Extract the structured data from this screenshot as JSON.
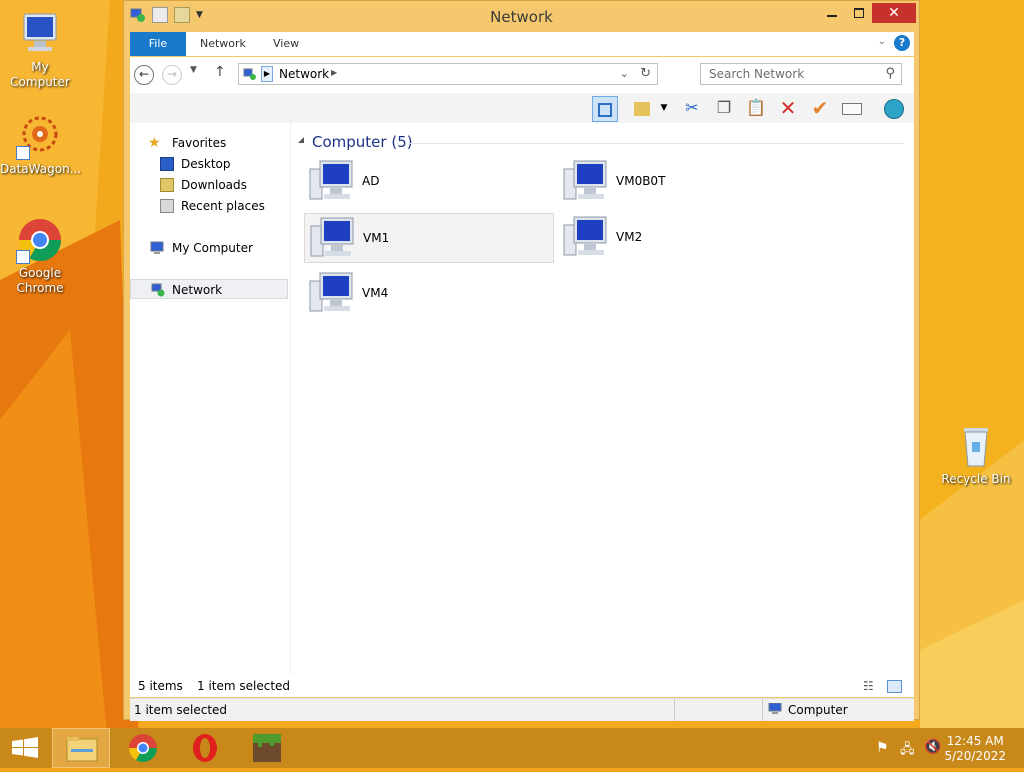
{
  "desktop": {
    "icons": [
      {
        "label": "My Computer"
      },
      {
        "label": "DataWagon..."
      },
      {
        "label": "Google Chrome"
      },
      {
        "label": "Recycle Bin"
      }
    ]
  },
  "window": {
    "title": "Network",
    "tabs": {
      "file": "File",
      "network": "Network",
      "view": "View"
    },
    "address": {
      "path_label": "Network"
    },
    "search": {
      "placeholder": "Search Network"
    },
    "nav": {
      "favorites": "Favorites",
      "desktop": "Desktop",
      "downloads": "Downloads",
      "recent": "Recent places",
      "my_computer": "My Computer",
      "network": "Network"
    },
    "group": {
      "header": "Computer (5)"
    },
    "items": [
      {
        "label": "AD"
      },
      {
        "label": "VM0B0T"
      },
      {
        "label": "VM1"
      },
      {
        "label": "VM2"
      },
      {
        "label": "VM4"
      }
    ],
    "status_inner": {
      "count": "5 items",
      "selected": "1 item selected"
    },
    "status_outer": {
      "selected": "1 item selected",
      "zone": "Computer"
    }
  },
  "taskbar": {
    "clock": {
      "time": "12:45 AM",
      "date": "5/20/2022"
    }
  },
  "colors": {
    "accent": "#1979ca",
    "close": "#c7312b",
    "taskbar": "#c8891a"
  }
}
